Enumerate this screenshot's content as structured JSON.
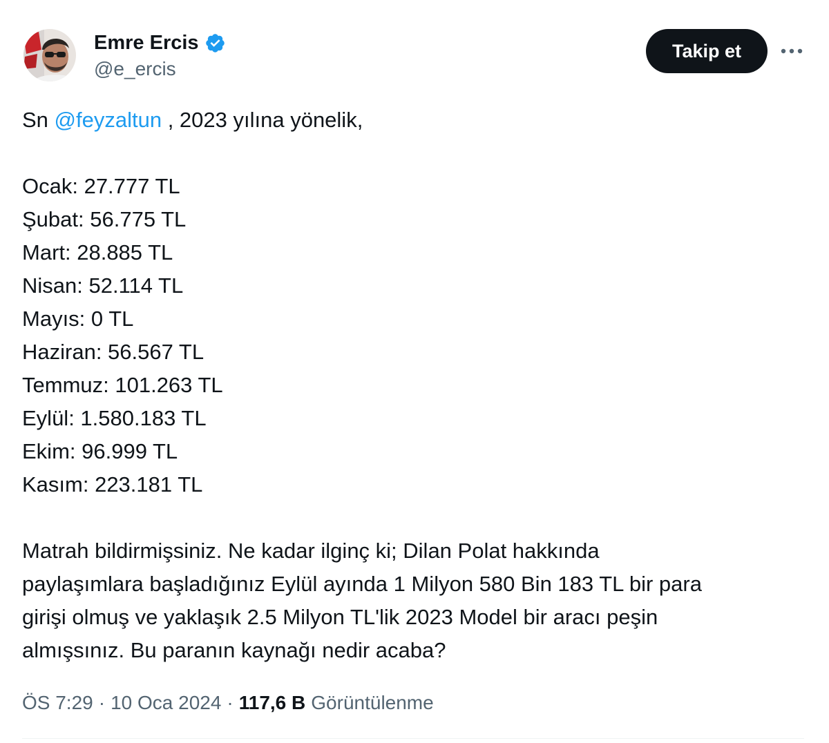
{
  "author": {
    "display_name": "Emre Ercis",
    "handle": "@e_ercis",
    "verified_icon": "verified-badge-icon",
    "avatar_icon": "avatar-photo"
  },
  "actions": {
    "follow_label": "Takip et",
    "more_icon": "more-options-icon"
  },
  "tweet": {
    "intro": {
      "prefix": "Sn ",
      "mention": "@feyzaltun",
      "suffix": " , 2023 yılına yönelik,"
    },
    "monthly_lines": [
      "Ocak: 27.777 TL",
      "Şubat: 56.775 TL",
      "Mart: 28.885 TL",
      "Nisan: 52.114 TL",
      "Mayıs: 0 TL",
      "Haziran: 56.567 TL",
      "Temmuz: 101.263 TL",
      "Eylül: 1.580.183 TL",
      "Ekim: 96.999 TL",
      "Kasım: 223.181 TL"
    ],
    "closing_lines": [
      "Matrah bildirmişsiniz. Ne kadar ilginç ki; Dilan Polat hakkında",
      "paylaşımlara başladığınız Eylül ayında 1 Milyon 580 Bin 183 TL bir para",
      "girişi olmuş ve yaklaşık 2.5 Milyon TL'lik 2023 Model bir aracı peşin",
      "almışsınız. Bu paranın kaynağı nedir acaba?"
    ]
  },
  "meta": {
    "time": "ÖS 7:29",
    "separator": "·",
    "date": "10 Oca 2024",
    "views_count": "117,6 B",
    "views_label": "Görüntülenme"
  },
  "colors": {
    "text": "#0f1419",
    "secondary": "#536471",
    "link": "#1d9bf0",
    "button_bg": "#0f1419",
    "button_text": "#ffffff",
    "verified": "#1d9bf0"
  }
}
